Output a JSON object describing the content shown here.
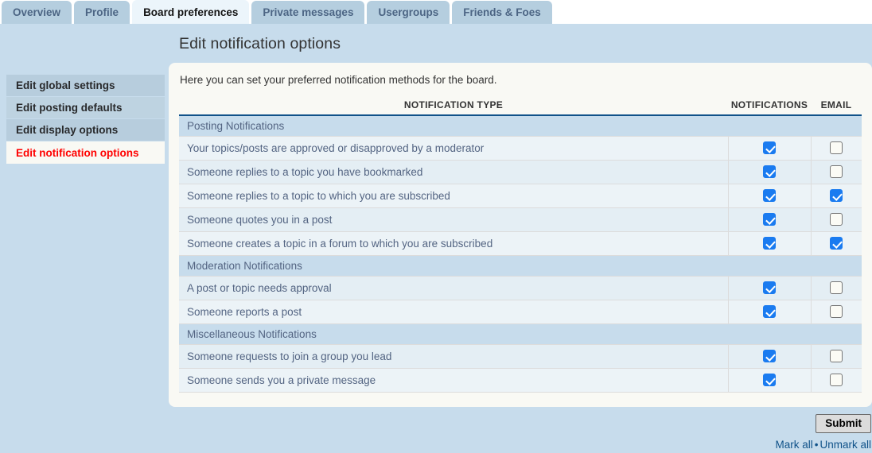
{
  "tabs": [
    {
      "label": "Overview",
      "active": false
    },
    {
      "label": "Profile",
      "active": false
    },
    {
      "label": "Board preferences",
      "active": true
    },
    {
      "label": "Private messages",
      "active": false
    },
    {
      "label": "Usergroups",
      "active": false
    },
    {
      "label": "Friends & Foes",
      "active": false
    }
  ],
  "sidebar": {
    "items": [
      {
        "label": "Edit global settings",
        "active": false
      },
      {
        "label": "Edit posting defaults",
        "active": false
      },
      {
        "label": "Edit display options",
        "active": false
      },
      {
        "label": "Edit notification options",
        "active": true
      }
    ]
  },
  "main": {
    "title": "Edit notification options",
    "intro": "Here you can set your preferred notification methods for the board.",
    "columns": {
      "type": "NOTIFICATION TYPE",
      "notifications": "NOTIFICATIONS",
      "email": "EMAIL"
    },
    "sections": [
      {
        "heading": "Posting Notifications",
        "rows": [
          {
            "label": "Your topics/posts are approved or disapproved by a moderator",
            "notifications": true,
            "email": false
          },
          {
            "label": "Someone replies to a topic you have bookmarked",
            "notifications": true,
            "email": false
          },
          {
            "label": "Someone replies to a topic to which you are subscribed",
            "notifications": true,
            "email": true
          },
          {
            "label": "Someone quotes you in a post",
            "notifications": true,
            "email": false
          },
          {
            "label": "Someone creates a topic in a forum to which you are subscribed",
            "notifications": true,
            "email": true
          }
        ]
      },
      {
        "heading": "Moderation Notifications",
        "rows": [
          {
            "label": "A post or topic needs approval",
            "notifications": true,
            "email": false
          },
          {
            "label": "Someone reports a post",
            "notifications": true,
            "email": false
          }
        ]
      },
      {
        "heading": "Miscellaneous Notifications",
        "rows": [
          {
            "label": "Someone requests to join a group you lead",
            "notifications": true,
            "email": false
          },
          {
            "label": "Someone sends you a private message",
            "notifications": true,
            "email": false
          }
        ]
      }
    ]
  },
  "footer": {
    "submit_label": "Submit",
    "mark_all": "Mark all",
    "separator": "•",
    "unmark_all": "Unmark all"
  },
  "colors": {
    "page_background": "#c7dcec",
    "panel_background": "#f9f9f4",
    "accent_blue": "#105289",
    "checkbox_on": "#1a7bf0",
    "active_link_red": "#ff0000"
  }
}
